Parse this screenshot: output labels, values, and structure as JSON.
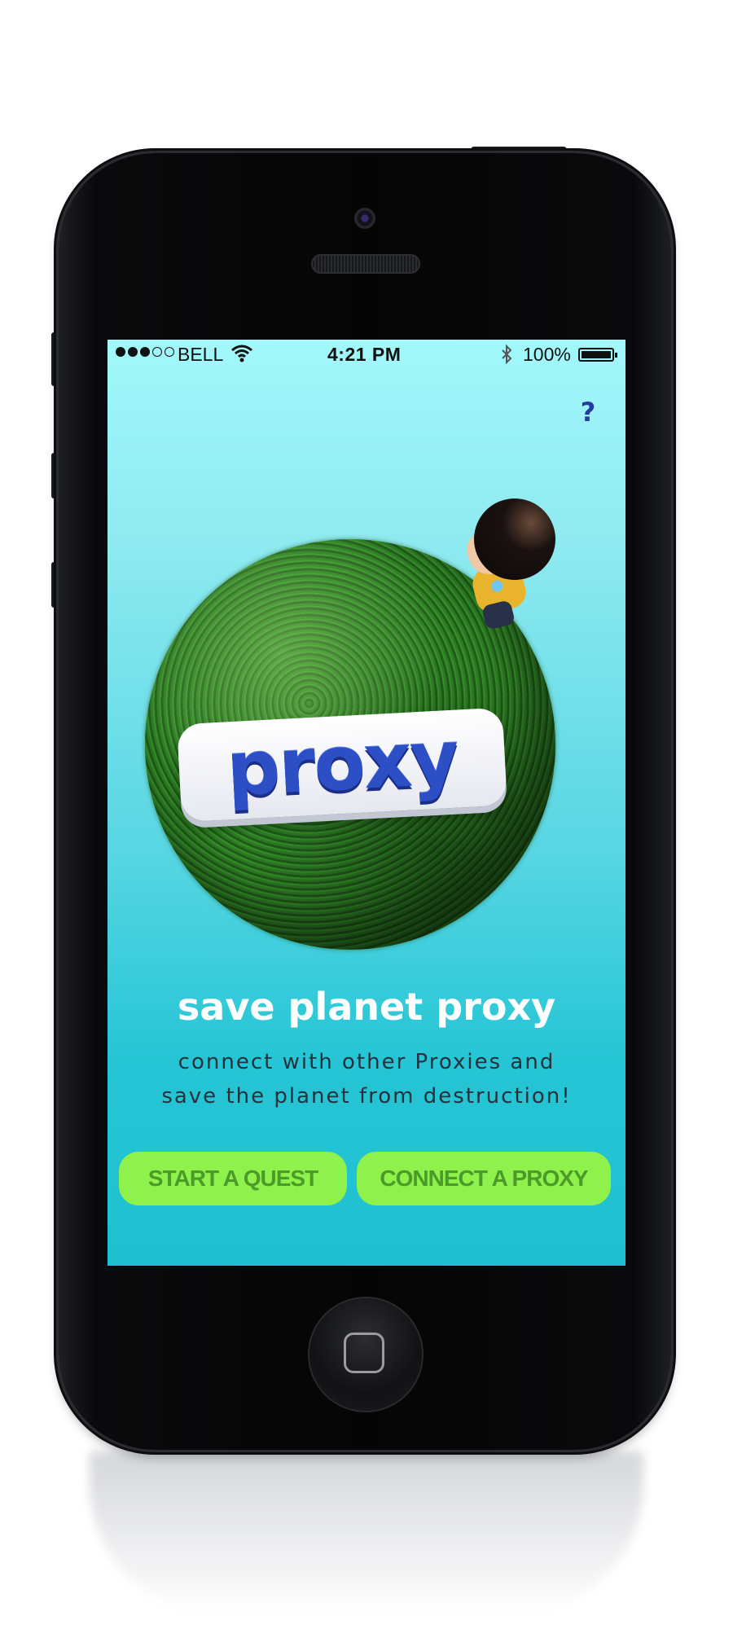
{
  "status_bar": {
    "signal_dots_filled": 3,
    "signal_dots_total": 5,
    "carrier": "BELL",
    "time": "4:21 PM",
    "battery_percent": "100%",
    "battery_level": 1.0,
    "icons": [
      "wifi-icon",
      "bluetooth-icon",
      "battery-icon"
    ]
  },
  "help": {
    "label": "?"
  },
  "hero": {
    "logo_text": "proxy",
    "logo_color": "#2d4fc6",
    "planet_color": "#2e7d25"
  },
  "main": {
    "headline": "save planet proxy",
    "subtext_line1": "connect with other Proxies and",
    "subtext_line2": "save the planet from destruction!"
  },
  "actions": {
    "start_quest": "START A QUEST",
    "connect_proxy": "CONNECT A PROXY",
    "button_color": "#8ff14c",
    "button_text_color": "#4c9a2a"
  },
  "theme": {
    "screen_top": "#a2f8fb",
    "screen_bottom": "#1ec0d0"
  }
}
